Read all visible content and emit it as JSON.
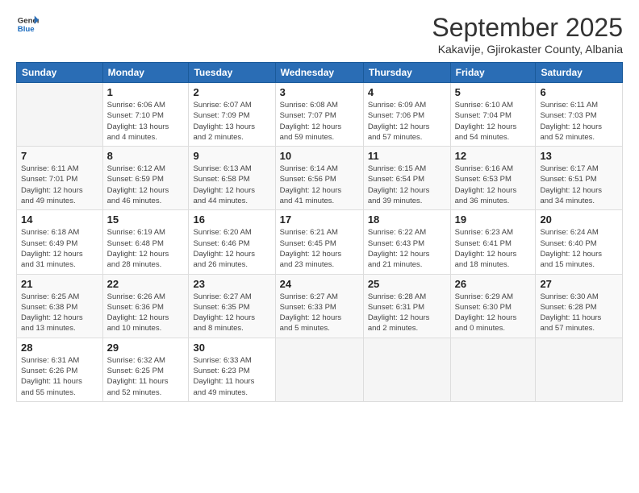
{
  "header": {
    "logo_general": "General",
    "logo_blue": "Blue",
    "month_title": "September 2025",
    "subtitle": "Kakavije, Gjirokaster County, Albania"
  },
  "calendar": {
    "days_of_week": [
      "Sunday",
      "Monday",
      "Tuesday",
      "Wednesday",
      "Thursday",
      "Friday",
      "Saturday"
    ],
    "weeks": [
      [
        {
          "day": "",
          "info": ""
        },
        {
          "day": "1",
          "info": "Sunrise: 6:06 AM\nSunset: 7:10 PM\nDaylight: 13 hours\nand 4 minutes."
        },
        {
          "day": "2",
          "info": "Sunrise: 6:07 AM\nSunset: 7:09 PM\nDaylight: 13 hours\nand 2 minutes."
        },
        {
          "day": "3",
          "info": "Sunrise: 6:08 AM\nSunset: 7:07 PM\nDaylight: 12 hours\nand 59 minutes."
        },
        {
          "day": "4",
          "info": "Sunrise: 6:09 AM\nSunset: 7:06 PM\nDaylight: 12 hours\nand 57 minutes."
        },
        {
          "day": "5",
          "info": "Sunrise: 6:10 AM\nSunset: 7:04 PM\nDaylight: 12 hours\nand 54 minutes."
        },
        {
          "day": "6",
          "info": "Sunrise: 6:11 AM\nSunset: 7:03 PM\nDaylight: 12 hours\nand 52 minutes."
        }
      ],
      [
        {
          "day": "7",
          "info": "Sunrise: 6:11 AM\nSunset: 7:01 PM\nDaylight: 12 hours\nand 49 minutes."
        },
        {
          "day": "8",
          "info": "Sunrise: 6:12 AM\nSunset: 6:59 PM\nDaylight: 12 hours\nand 46 minutes."
        },
        {
          "day": "9",
          "info": "Sunrise: 6:13 AM\nSunset: 6:58 PM\nDaylight: 12 hours\nand 44 minutes."
        },
        {
          "day": "10",
          "info": "Sunrise: 6:14 AM\nSunset: 6:56 PM\nDaylight: 12 hours\nand 41 minutes."
        },
        {
          "day": "11",
          "info": "Sunrise: 6:15 AM\nSunset: 6:54 PM\nDaylight: 12 hours\nand 39 minutes."
        },
        {
          "day": "12",
          "info": "Sunrise: 6:16 AM\nSunset: 6:53 PM\nDaylight: 12 hours\nand 36 minutes."
        },
        {
          "day": "13",
          "info": "Sunrise: 6:17 AM\nSunset: 6:51 PM\nDaylight: 12 hours\nand 34 minutes."
        }
      ],
      [
        {
          "day": "14",
          "info": "Sunrise: 6:18 AM\nSunset: 6:49 PM\nDaylight: 12 hours\nand 31 minutes."
        },
        {
          "day": "15",
          "info": "Sunrise: 6:19 AM\nSunset: 6:48 PM\nDaylight: 12 hours\nand 28 minutes."
        },
        {
          "day": "16",
          "info": "Sunrise: 6:20 AM\nSunset: 6:46 PM\nDaylight: 12 hours\nand 26 minutes."
        },
        {
          "day": "17",
          "info": "Sunrise: 6:21 AM\nSunset: 6:45 PM\nDaylight: 12 hours\nand 23 minutes."
        },
        {
          "day": "18",
          "info": "Sunrise: 6:22 AM\nSunset: 6:43 PM\nDaylight: 12 hours\nand 21 minutes."
        },
        {
          "day": "19",
          "info": "Sunrise: 6:23 AM\nSunset: 6:41 PM\nDaylight: 12 hours\nand 18 minutes."
        },
        {
          "day": "20",
          "info": "Sunrise: 6:24 AM\nSunset: 6:40 PM\nDaylight: 12 hours\nand 15 minutes."
        }
      ],
      [
        {
          "day": "21",
          "info": "Sunrise: 6:25 AM\nSunset: 6:38 PM\nDaylight: 12 hours\nand 13 minutes."
        },
        {
          "day": "22",
          "info": "Sunrise: 6:26 AM\nSunset: 6:36 PM\nDaylight: 12 hours\nand 10 minutes."
        },
        {
          "day": "23",
          "info": "Sunrise: 6:27 AM\nSunset: 6:35 PM\nDaylight: 12 hours\nand 8 minutes."
        },
        {
          "day": "24",
          "info": "Sunrise: 6:27 AM\nSunset: 6:33 PM\nDaylight: 12 hours\nand 5 minutes."
        },
        {
          "day": "25",
          "info": "Sunrise: 6:28 AM\nSunset: 6:31 PM\nDaylight: 12 hours\nand 2 minutes."
        },
        {
          "day": "26",
          "info": "Sunrise: 6:29 AM\nSunset: 6:30 PM\nDaylight: 12 hours\nand 0 minutes."
        },
        {
          "day": "27",
          "info": "Sunrise: 6:30 AM\nSunset: 6:28 PM\nDaylight: 11 hours\nand 57 minutes."
        }
      ],
      [
        {
          "day": "28",
          "info": "Sunrise: 6:31 AM\nSunset: 6:26 PM\nDaylight: 11 hours\nand 55 minutes."
        },
        {
          "day": "29",
          "info": "Sunrise: 6:32 AM\nSunset: 6:25 PM\nDaylight: 11 hours\nand 52 minutes."
        },
        {
          "day": "30",
          "info": "Sunrise: 6:33 AM\nSunset: 6:23 PM\nDaylight: 11 hours\nand 49 minutes."
        },
        {
          "day": "",
          "info": ""
        },
        {
          "day": "",
          "info": ""
        },
        {
          "day": "",
          "info": ""
        },
        {
          "day": "",
          "info": ""
        }
      ]
    ]
  }
}
